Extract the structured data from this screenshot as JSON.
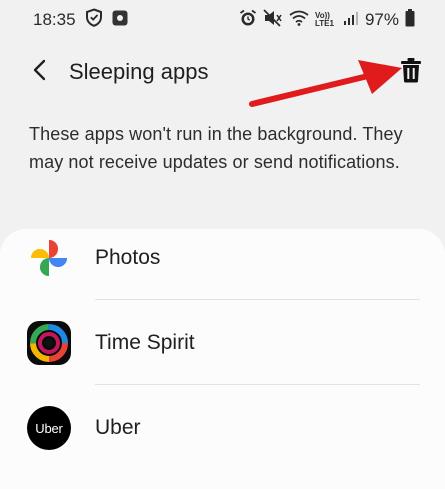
{
  "status_bar": {
    "time": "18:35",
    "battery_percent": "97%",
    "network_label": "Vo)) LTE1",
    "icons": [
      "shield-icon",
      "square-app-icon",
      "alarm-icon",
      "mute-icon",
      "wifi-icon",
      "signal-icon",
      "battery-icon"
    ]
  },
  "header": {
    "title": "Sleeping apps",
    "back_icon": "back-arrow-icon",
    "delete_icon": "trash-icon"
  },
  "description": "These apps won't run in the background. They may not receive updates or send notifications.",
  "apps": [
    {
      "name": "Photos",
      "icon": "google-photos-icon"
    },
    {
      "name": "Time Spirit",
      "icon": "time-spirit-icon"
    },
    {
      "name": "Uber",
      "icon": "uber-icon",
      "icon_text": "Uber"
    }
  ],
  "colors": {
    "background": "#f1f1f1",
    "card": "#fcfcfc",
    "annotation_arrow": "#e01b1b"
  }
}
